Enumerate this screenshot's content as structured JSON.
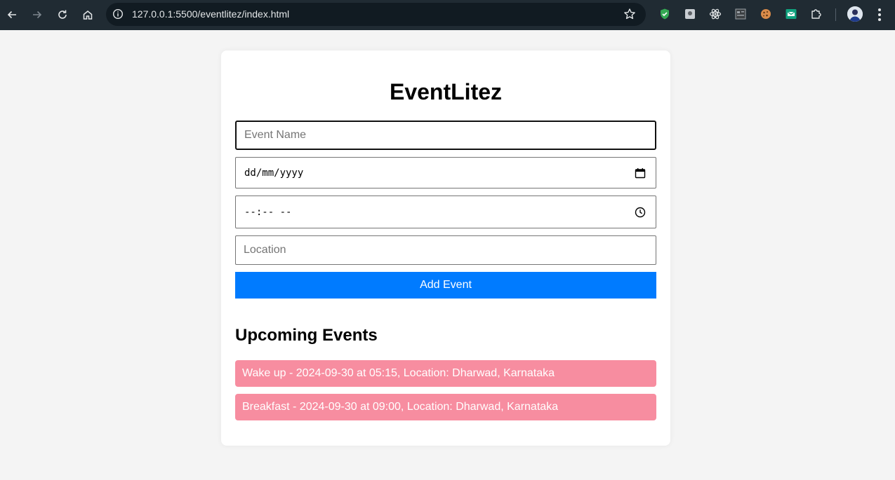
{
  "browser": {
    "url": "127.0.0.1:5500/eventlitez/index.html",
    "nav_icons": [
      "back-arrow-icon",
      "forward-arrow-icon",
      "reload-icon",
      "home-icon"
    ],
    "extensions": [
      "shield-extension-icon",
      "image-extension-icon",
      "react-devtools-icon",
      "grid-extension-icon",
      "cookie-extension-icon",
      "mail-extension-icon",
      "puzzle-icon"
    ]
  },
  "app": {
    "title": "EventLitez",
    "form": {
      "name_placeholder": "Event Name",
      "date_placeholder": "dd/mm/yyyy",
      "time_placeholder": "--:-- --",
      "location_placeholder": "Location",
      "submit_label": "Add Event"
    },
    "upcoming_title": "Upcoming Events",
    "events": [
      "Wake up - 2024-09-30 at 05:15, Location: Dharwad, Karnataka",
      "Breakfast - 2024-09-30 at 09:00, Location: Dharwad, Karnataka"
    ]
  },
  "colors": {
    "accent": "#007bff",
    "event_bg": "#f78da0",
    "page_bg": "#f4f4f4"
  }
}
